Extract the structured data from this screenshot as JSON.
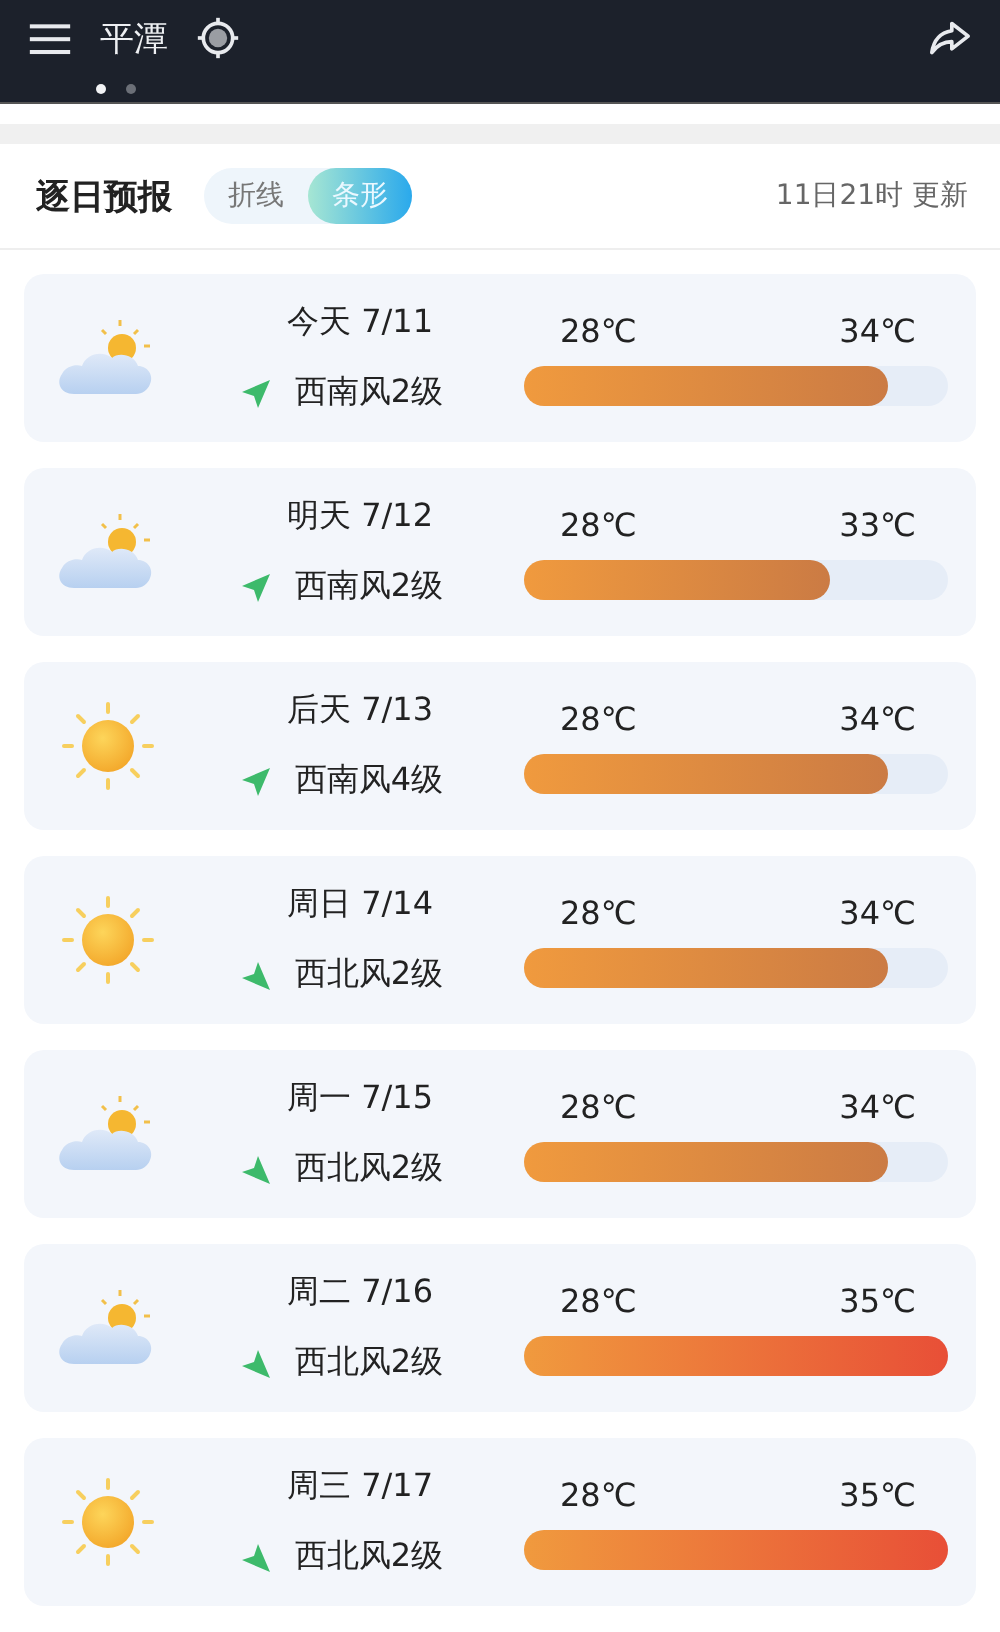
{
  "top_bar": {
    "city": "平潭",
    "pages": [
      {
        "selected": true
      },
      {
        "selected": false
      }
    ]
  },
  "header": {
    "title": "逐日预报",
    "toggle": [
      {
        "label": "折线",
        "selected": false
      },
      {
        "label": "条形",
        "selected": true
      }
    ],
    "updated": "11日21时 更新"
  },
  "days": [
    {
      "day": "今天 7/11",
      "weather": {
        "kind": "partly-cloudy"
      },
      "wind": {
        "kind": "sw",
        "text": "西南风2级"
      },
      "low": "28℃",
      "high": "34℃",
      "level": 0.86,
      "color": "#cb7b44"
    },
    {
      "day": "明天 7/12",
      "weather": {
        "kind": "partly-cloudy"
      },
      "wind": {
        "kind": "sw",
        "text": "西南风2级"
      },
      "low": "28℃",
      "high": "33℃",
      "level": 0.72,
      "color": "#cb7b44"
    },
    {
      "day": "后天 7/13",
      "weather": {
        "kind": "sunny"
      },
      "wind": {
        "kind": "sw",
        "text": "西南风4级"
      },
      "low": "28℃",
      "high": "34℃",
      "level": 0.86,
      "color": "#cb7b44"
    },
    {
      "day": "周日 7/14",
      "weather": {
        "kind": "sunny"
      },
      "wind": {
        "kind": "nw",
        "text": "西北风2级"
      },
      "low": "28℃",
      "high": "34℃",
      "level": 0.86,
      "color": "#cb7b44"
    },
    {
      "day": "周一 7/15",
      "weather": {
        "kind": "partly-cloudy"
      },
      "wind": {
        "kind": "nw",
        "text": "西北风2级"
      },
      "low": "28℃",
      "high": "34℃",
      "level": 0.86,
      "color": "#cb7b44"
    },
    {
      "day": "周二 7/16",
      "weather": {
        "kind": "partly-cloudy"
      },
      "wind": {
        "kind": "nw",
        "text": "西北风2级"
      },
      "low": "28℃",
      "high": "35℃",
      "level": 1.0,
      "color": "#e84f37"
    },
    {
      "day": "周三 7/17",
      "weather": {
        "kind": "sunny"
      },
      "wind": {
        "kind": "nw",
        "text": "西北风2级"
      },
      "low": "28℃",
      "high": "35℃",
      "level": 1.0,
      "color": "#e84f37"
    }
  ]
}
